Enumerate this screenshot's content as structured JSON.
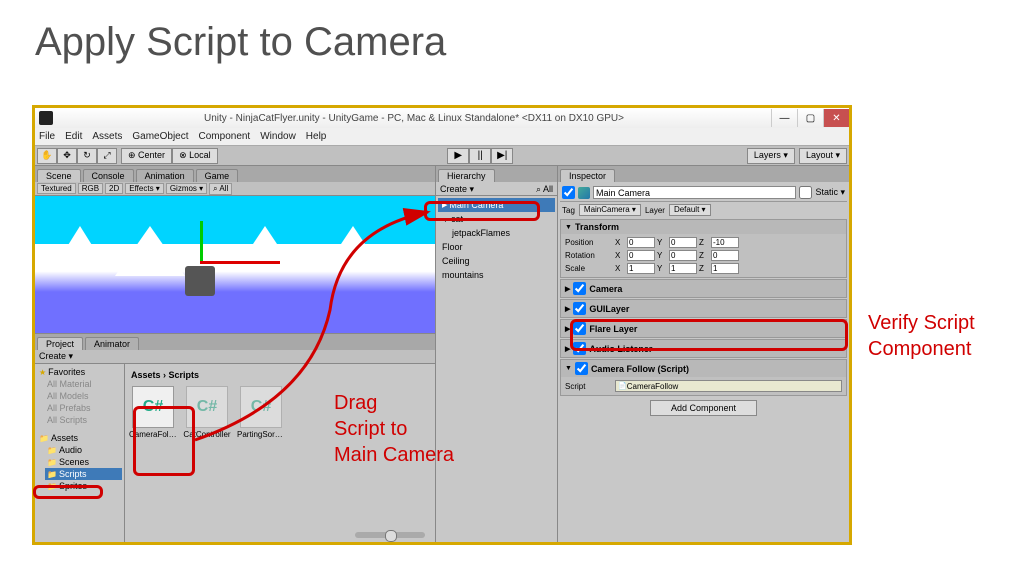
{
  "slide_title": "Apply Script to Camera",
  "window": {
    "title": "Unity - NinjaCatFlyer.unity - UnityGame - PC, Mac & Linux Standalone* <DX11 on DX10 GPU>",
    "min": "—",
    "max": "▢",
    "close": "✕"
  },
  "menu": [
    "File",
    "Edit",
    "Assets",
    "GameObject",
    "Component",
    "Window",
    "Help"
  ],
  "pivot": {
    "center": "⊕ Center",
    "local": "⊗ Local"
  },
  "play": {
    "play": "▶",
    "pause": "||",
    "step": "▶|"
  },
  "top_dropdowns": {
    "layers": "Layers ▾",
    "layout": "Layout ▾"
  },
  "scene_tabs": [
    "Scene",
    "Console",
    "Animation",
    "Game"
  ],
  "scene_toolbar": {
    "textured": "Textured",
    "rgb": "RGB",
    "twod": "2D",
    "effects": "Effects ▾",
    "gizmos": "Gizmos ▾",
    "search": "⌕ All"
  },
  "project_tabs": [
    "Project",
    "Animator"
  ],
  "project": {
    "create": "Create ▾",
    "tree": {
      "favorites": "Favorites",
      "all_materials": "All Material",
      "all_models": "All Models",
      "all_prefabs": "All Prefabs",
      "all_scripts": "All Scripts",
      "assets": "Assets",
      "audio": "Audio",
      "scenes": "Scenes",
      "scripts": "Scripts",
      "sprites": "Sprites"
    },
    "breadcrumb": "Assets › Scripts",
    "items": [
      {
        "name": "CameraFollov",
        "lang": "C#"
      },
      {
        "name": "CatController",
        "lang": "C#"
      },
      {
        "name": "PartingSortin…",
        "lang": "C#"
      }
    ]
  },
  "hierarchy": {
    "tab": "Hierarchy",
    "create": "Create ▾",
    "search": "⌕ All",
    "items": [
      "Main Camera",
      "cat",
      "jetpackFlames",
      "Floor",
      "Ceiling",
      "mountains"
    ]
  },
  "inspector": {
    "tab": "Inspector",
    "object_name": "Main Camera",
    "static_label": "Static ▾",
    "tag_label": "Tag",
    "tag_value": "MainCamera ▾",
    "layer_label": "Layer",
    "layer_value": "Default ▾",
    "transform": {
      "title": "Transform",
      "position_label": "Position",
      "rotation_label": "Rotation",
      "scale_label": "Scale",
      "position": {
        "x": "0",
        "y": "0",
        "z": "-10"
      },
      "rotation": {
        "x": "0",
        "y": "0",
        "z": "0"
      },
      "scale": {
        "x": "1",
        "y": "1",
        "z": "1"
      }
    },
    "components": {
      "camera": "Camera",
      "guilayer": "GUILayer",
      "flare": "Flare Layer",
      "audio": "Audio Listener",
      "script_comp": "Camera Follow (Script)",
      "script_label": "Script",
      "script_value": "CameraFollow"
    },
    "add_component": "Add Component"
  },
  "annotations": {
    "drag": "Drag\nScript to\nMain Camera",
    "verify": "Verify Script\nComponent"
  }
}
